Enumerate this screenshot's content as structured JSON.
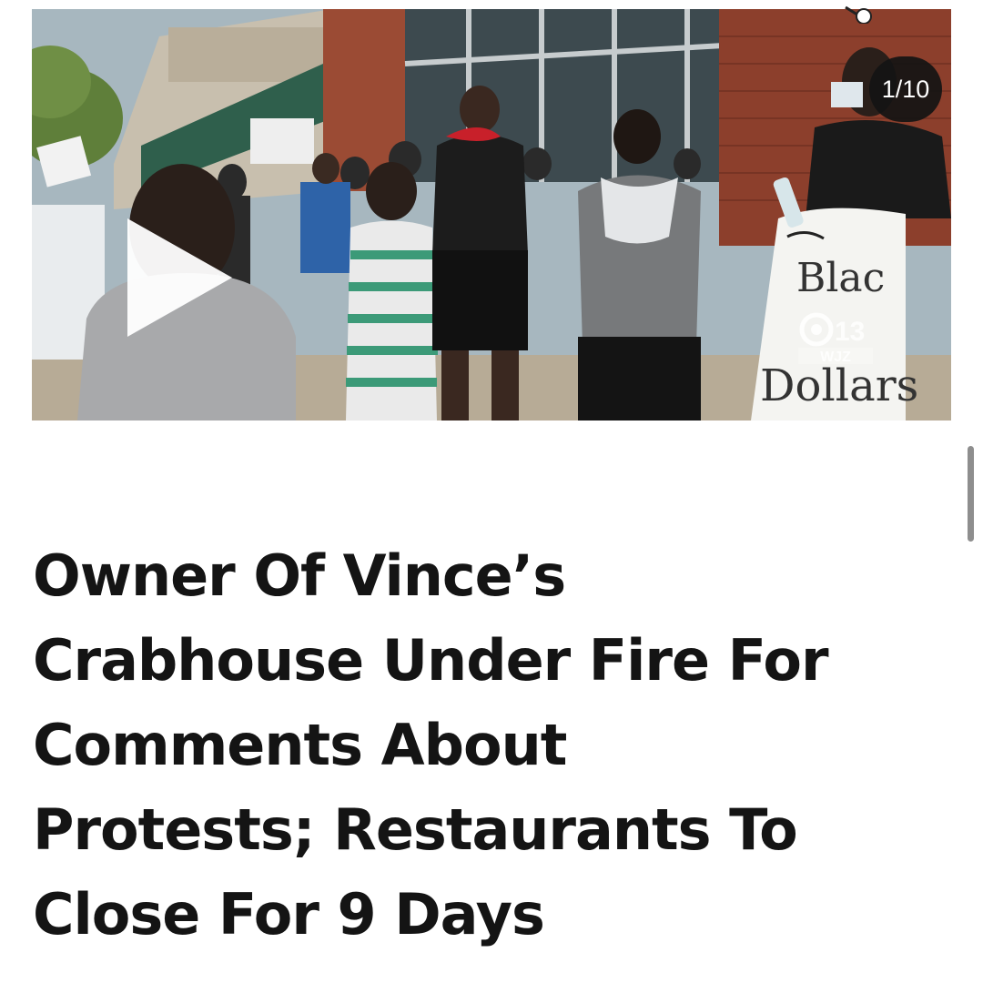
{
  "media": {
    "counter": "1/10",
    "play_icon": "play-icon",
    "channel_logo": {
      "number": "13",
      "call_sign": "WJZ"
    },
    "sign_text": {
      "black_dollars_sign": "Black Dollars"
    }
  },
  "article": {
    "headline_lines": [
      "Owner Of Vince’s",
      "Crabhouse Under Fire For",
      "Comments About",
      "Protests; Restaurants To",
      "Close For 9 Days"
    ]
  },
  "colors": {
    "headline_text": "#141414",
    "badge_background": "#141414",
    "scrollbar": "#8e8e8e"
  }
}
